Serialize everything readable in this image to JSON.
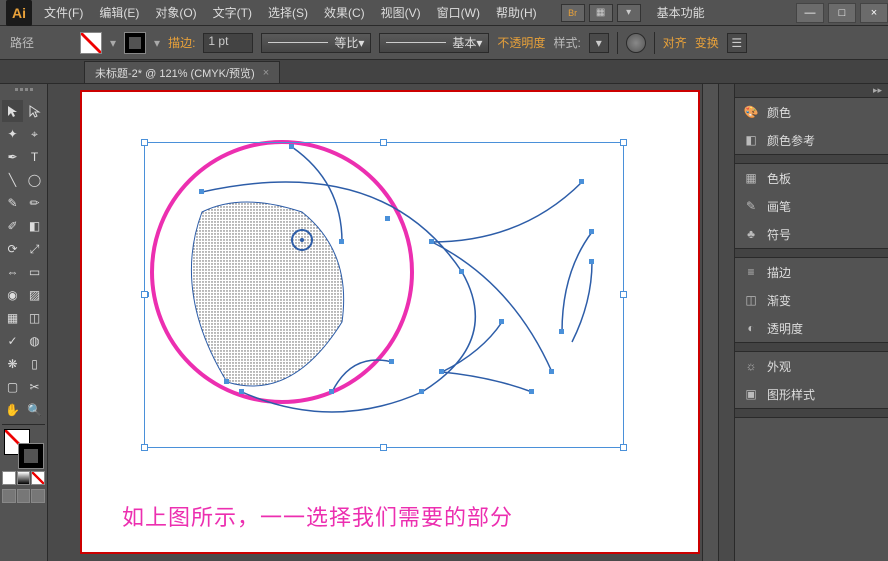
{
  "app": {
    "icon_text": "Ai",
    "workspace": "基本功能"
  },
  "menu": {
    "file": "文件(F)",
    "edit": "编辑(E)",
    "object": "对象(O)",
    "type": "文字(T)",
    "select": "选择(S)",
    "effect": "效果(C)",
    "view": "视图(V)",
    "window": "窗口(W)",
    "help": "帮助(H)"
  },
  "control": {
    "path_label": "路径",
    "stroke_label": "描边:",
    "stroke_value": "1 pt",
    "profile_label": "等比",
    "brush_label": "基本",
    "opacity_label": "不透明度",
    "style_label": "样式:",
    "align_label": "对齐",
    "transform_label": "变换"
  },
  "tab": {
    "title": "未标题-2* @ 121% (CMYK/预览)",
    "close": "×"
  },
  "panels": {
    "color": "颜色",
    "color_guide": "颜色参考",
    "swatches": "色板",
    "brushes": "画笔",
    "symbols": "符号",
    "stroke": "描边",
    "gradient": "渐变",
    "transparency": "透明度",
    "appearance": "外观",
    "graphic_styles": "图形样式"
  },
  "caption": "如上图所示，一一选择我们需要的部分",
  "win": {
    "min": "—",
    "max": "□",
    "close": "×"
  }
}
